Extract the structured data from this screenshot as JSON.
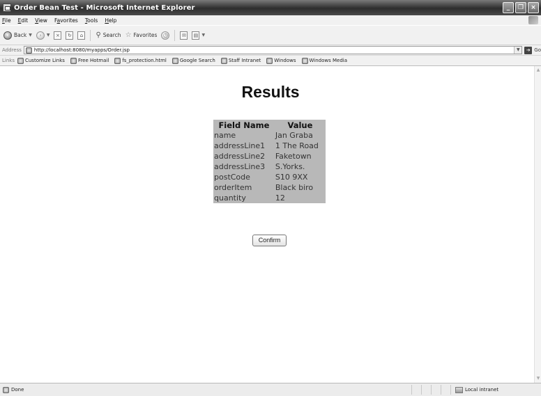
{
  "window": {
    "title": "Order Bean Test - Microsoft Internet Explorer",
    "minimize_glyph": "_",
    "restore_glyph": "❐",
    "close_glyph": "×"
  },
  "menu": {
    "items": [
      {
        "accel": "F",
        "rest": "ile"
      },
      {
        "accel": "E",
        "rest": "dit"
      },
      {
        "accel": "V",
        "rest": "iew"
      },
      {
        "pre": "F",
        "accel": "a",
        "rest": "vorites"
      },
      {
        "accel": "T",
        "rest": "ools"
      },
      {
        "accel": "H",
        "rest": "elp"
      }
    ]
  },
  "toolbar": {
    "back_label": "Back",
    "search_label": "Search",
    "favorites_label": "Favorites"
  },
  "address": {
    "label": "Address",
    "url": "http://localhost:8080/myapps/Order.jsp",
    "go_label": "Go"
  },
  "links": {
    "label": "Links",
    "items": [
      "Customize Links",
      "Free Hotmail",
      "fs_protection.html",
      "Google Search",
      "Staff Intranet",
      "Windows",
      "Windows Media"
    ]
  },
  "page": {
    "heading": "Results",
    "table": {
      "headers": [
        "Field Name",
        "Value"
      ],
      "rows": [
        [
          "name",
          "Jan Graba"
        ],
        [
          "addressLine1",
          "1 The Road"
        ],
        [
          "addressLine2",
          "Faketown"
        ],
        [
          "addressLine3",
          "S.Yorks."
        ],
        [
          "postCode",
          "S10 9XX"
        ],
        [
          "orderItem",
          "Black biro"
        ],
        [
          "quantity",
          "12"
        ]
      ]
    },
    "confirm_label": "Confirm"
  },
  "status": {
    "text": "Done",
    "zone": "Local intranet"
  }
}
